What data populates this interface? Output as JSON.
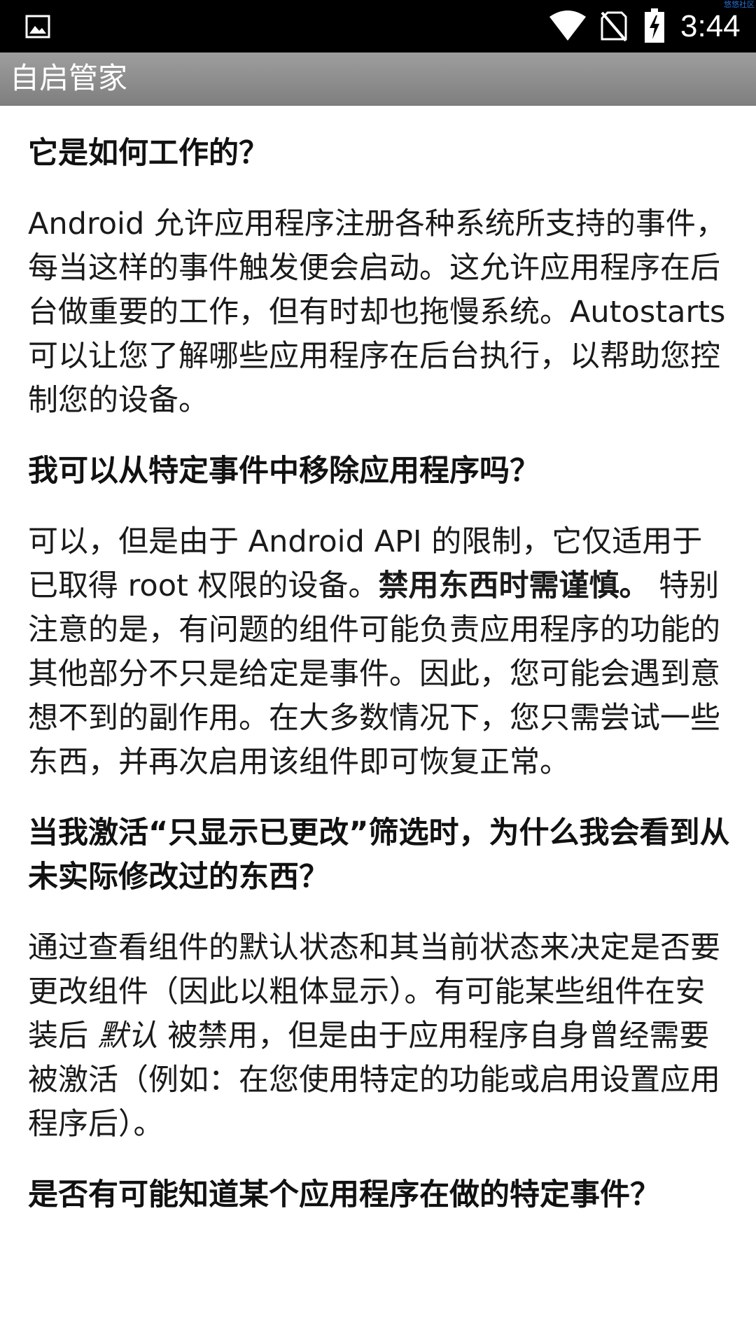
{
  "status_bar": {
    "time": "3:44",
    "watermark": "悠悠社区",
    "icons": [
      "gallery-icon",
      "wifi-icon",
      "no-sim-icon",
      "battery-charging-icon"
    ]
  },
  "action_bar": {
    "title": "自启管家"
  },
  "faq": {
    "q1": {
      "question": "它是如何工作的？",
      "answer": "Android 允许应用程序注册各种系统所支持的事件，每当这样的事件触发便会启动。这允许应用程序在后台做重要的工作，但有时却也拖慢系统。Autostarts 可以让您了解哪些应用程序在后台执行，以帮助您控制您的设备。"
    },
    "q2": {
      "question": "我可以从特定事件中移除应用程序吗？",
      "answer_part1": "可以，但是由于 Android API 的限制，它仅适用于已取得 root 权限的设备。",
      "answer_bold": "禁用东西时需谨慎。",
      "answer_part2": " 特别注意的是，有问题的组件可能负责应用程序的功能的其他部分不只是给定是事件。因此，您可能会遇到意想不到的副作用。在大多数情况下，您只需尝试一些东西，并再次启用该组件即可恢复正常。"
    },
    "q3": {
      "question": "当我激活“只显示已更改”筛选时，为什么我会看到从未实际修改过的东西？",
      "answer_part1": "通过查看组件的默认状态和其当前状态来决定是否要更改组件（因此以粗体显示）。有可能某些组件在安装后 ",
      "answer_italic": "默认",
      "answer_part2": " 被禁用，但是由于应用程序自身曾经需要被激活（例如：在您使用特定的功能或启用设置应用程序后）。"
    },
    "q4": {
      "question": "是否有可能知道某个应用程序在做的特定事件？"
    }
  }
}
